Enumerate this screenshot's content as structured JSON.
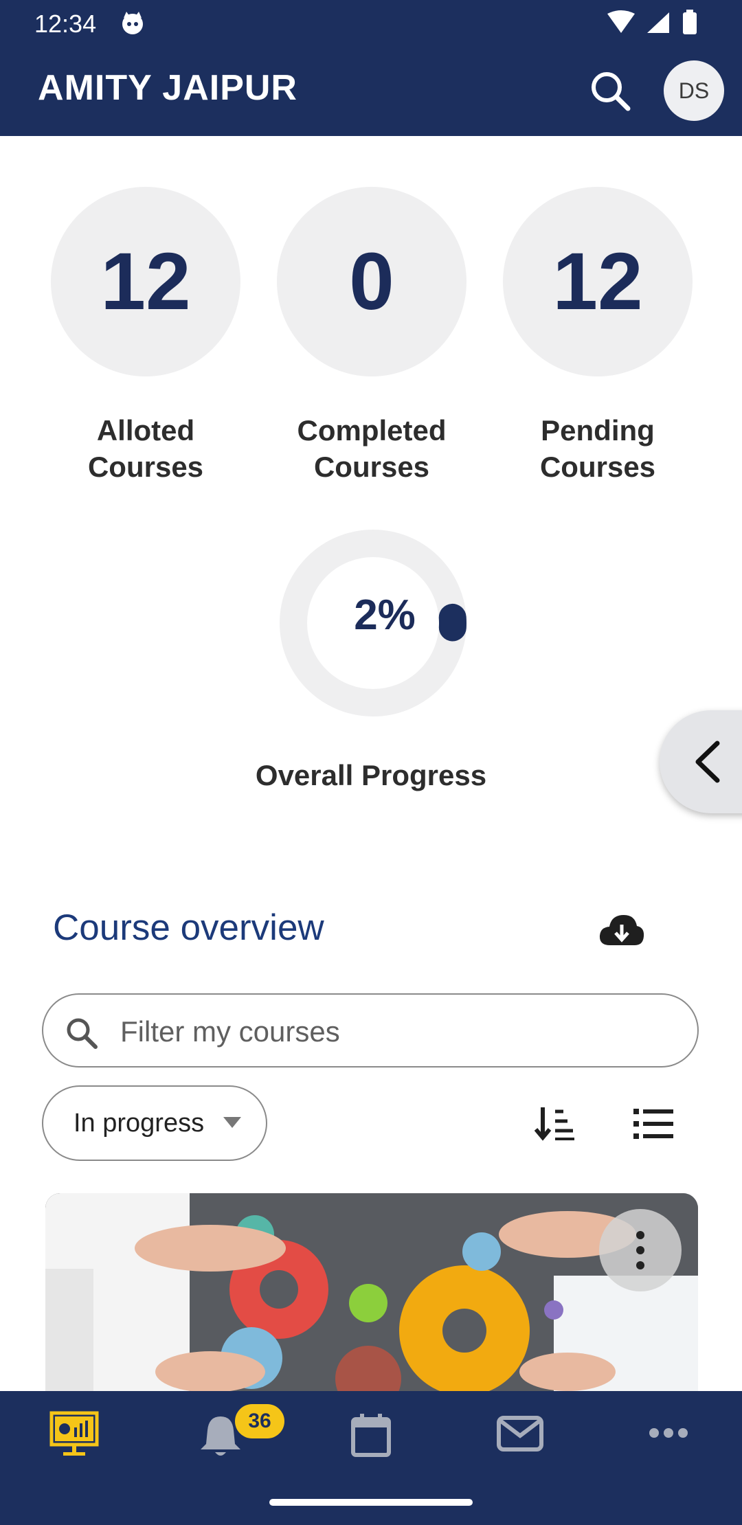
{
  "status_bar": {
    "time": "12:34"
  },
  "app_bar": {
    "title": "AMITY JAIPUR",
    "avatar_initials": "DS"
  },
  "stats": [
    {
      "value": "12",
      "label_line1": "Alloted",
      "label_line2": "Courses"
    },
    {
      "value": "0",
      "label_line1": "Completed",
      "label_line2": "Courses"
    },
    {
      "value": "12",
      "label_line1": "Pending",
      "label_line2": "Courses"
    }
  ],
  "progress": {
    "text": "2%",
    "value": 2,
    "label": "Overall Progress"
  },
  "course_overview": {
    "title": "Course overview",
    "filter_placeholder": "Filter my courses",
    "status_filter": "In progress"
  },
  "bottom_nav": {
    "notifications_badge": "36",
    "items": [
      "dashboard-icon",
      "bell-icon",
      "calendar-icon",
      "mail-icon",
      "more-icon"
    ]
  },
  "colors": {
    "primary": "#1c2f5e",
    "accent": "#f5c518",
    "circle_bg": "#efeff0"
  }
}
